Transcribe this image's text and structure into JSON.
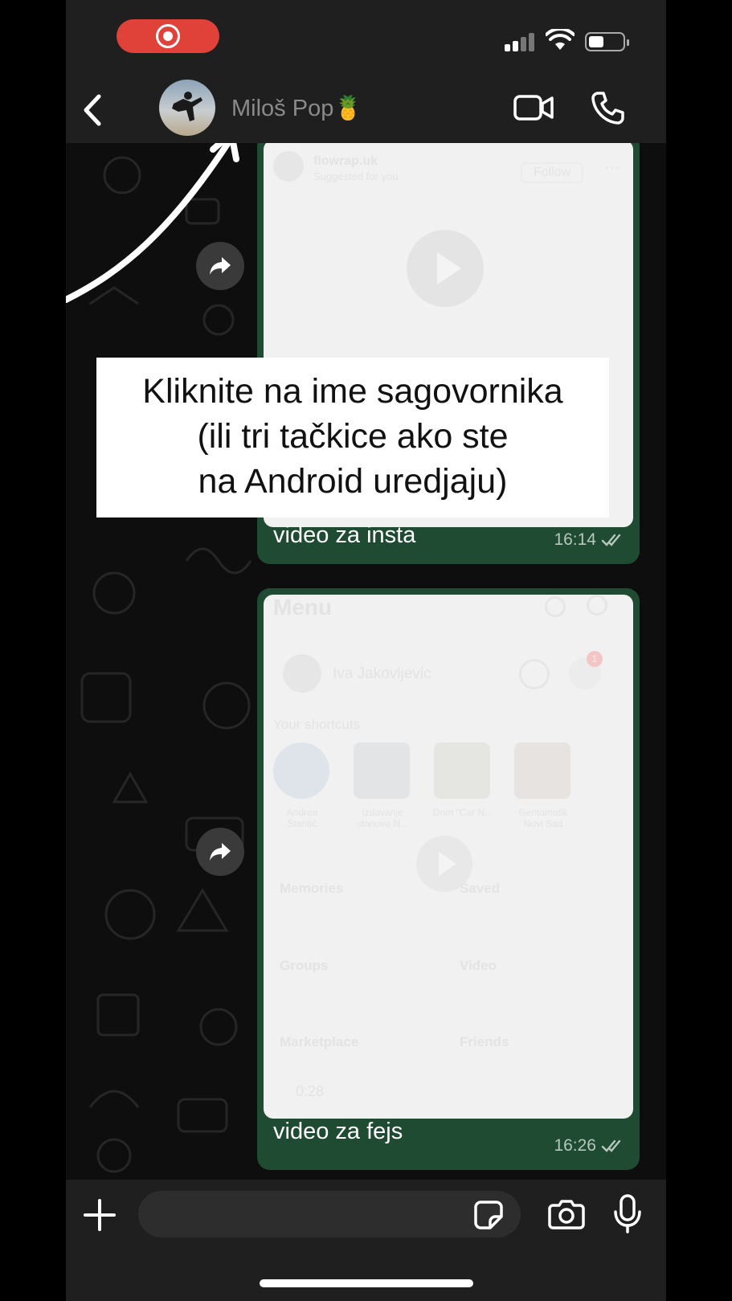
{
  "header": {
    "contact_name": "Miloš Pop🍍"
  },
  "overlay": {
    "line1": "Kliknite na ime sagovornika",
    "line2": "(ili tri tačkice ako ste",
    "line3": "na Android uredjaju)"
  },
  "messages": [
    {
      "caption": "video za insta",
      "time": "16:14",
      "media": {
        "account": "flowrap.uk",
        "subtitle": "Suggested for you",
        "follow": "Follow"
      }
    },
    {
      "caption": "video za fejs",
      "time": "16:26",
      "media": {
        "title": "Menu",
        "profile_name": "Iva Jakovljevic",
        "shortcuts_label": "Your shortcuts",
        "shortcuts": [
          "Andrea Stantić",
          "Izdavanje stanova N...",
          "Dnm \"Car N...",
          "Gentamatik Novi Sad"
        ],
        "tiles": [
          "Memories",
          "Saved",
          "Groups",
          "Video",
          "Marketplace",
          "Friends"
        ],
        "duration": "0:28",
        "badge": "1"
      }
    }
  ],
  "colors": {
    "bubble": "#1f4b32",
    "record": "#e0423a",
    "bar": "#1f1f1f"
  }
}
